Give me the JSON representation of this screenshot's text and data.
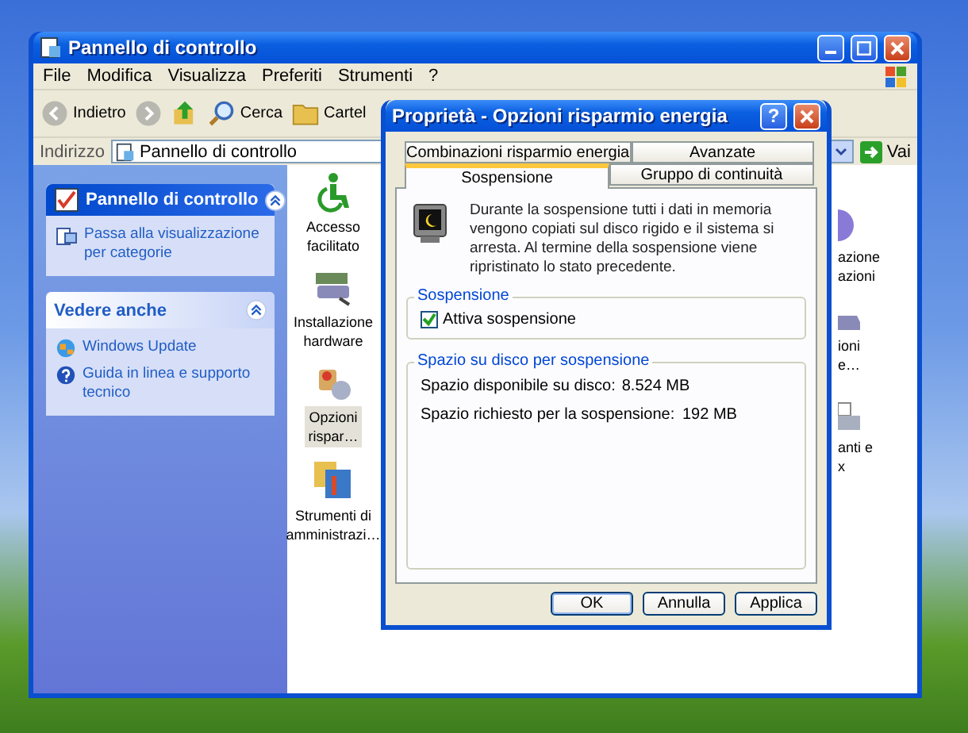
{
  "explorer": {
    "title": "Pannello di controllo",
    "menu": [
      "File",
      "Modifica",
      "Visualizza",
      "Preferiti",
      "Strumenti",
      "?"
    ],
    "toolbar": [
      {
        "kind": "back",
        "label": "Indietro"
      },
      {
        "kind": "forward"
      },
      {
        "kind": "up"
      },
      {
        "kind": "search",
        "label": "Cerca"
      },
      {
        "kind": "folders",
        "label": "Cartel"
      }
    ],
    "address": {
      "label": "Indirizzo",
      "value": "Pannello di controllo",
      "go": "Vai"
    },
    "sidebar": [
      {
        "kind": "primary",
        "title": "Pannello di controllo",
        "links": [
          {
            "kind": "switch",
            "label": "Passa alla visualizzazione per categorie"
          }
        ]
      },
      {
        "kind": "secondary",
        "title": "Vedere anche",
        "links": [
          {
            "kind": "update",
            "label": "Windows Update"
          },
          {
            "kind": "help",
            "label": "Guida in linea e supporto tecnico"
          }
        ]
      }
    ],
    "items": [
      {
        "kind": "accessibility",
        "lines": [
          "Accesso",
          "facilitato"
        ],
        "selected": false
      },
      {
        "kind": "hardware",
        "lines": [
          "Installazione",
          "hardware"
        ],
        "selected": false
      },
      {
        "kind": "power",
        "lines": [
          "Opzioni",
          "rispar…"
        ],
        "selected": true
      },
      {
        "kind": "tools",
        "lines": [
          "Strumenti di",
          "amministrazi…"
        ],
        "selected": false
      }
    ],
    "cut_items": [
      {
        "kind": "globe",
        "lines": [
          "azione",
          "azioni"
        ]
      },
      {
        "kind": "drive",
        "lines": [
          "ioni",
          "e…"
        ]
      },
      {
        "kind": "printer",
        "lines": [
          "anti e",
          "x"
        ]
      }
    ]
  },
  "dialog": {
    "title": "Proprietà - Opzioni risparmio energia",
    "help": "?",
    "tab_rows": [
      [
        {
          "label": "Combinazioni risparmio energia",
          "selected": false
        },
        {
          "label": "Avanzate",
          "selected": false
        }
      ],
      [
        {
          "label": "Sospensione",
          "selected": true
        },
        {
          "label": "Gruppo di continuità",
          "selected": false
        }
      ]
    ],
    "description": "Durante la sospensione tutti i dati in memoria vengono copiati sul disco rigido e il sistema si arresta. Al termine della sospensione viene ripristinato lo stato precedente.",
    "groups": [
      {
        "kind": "checkbox",
        "title": "Sospensione",
        "label": "Attiva sospensione",
        "checked": true
      },
      {
        "kind": "info",
        "title": "Spazio su disco per sospensione",
        "rows": [
          {
            "label": "Spazio disponibile su disco:",
            "value": "8.524 MB"
          },
          {
            "label": "Spazio richiesto per la sospensione:",
            "value": "192 MB"
          }
        ]
      }
    ],
    "buttons": [
      {
        "label": "OK",
        "focused": true
      },
      {
        "label": "Annulla",
        "focused": false
      },
      {
        "label": "Applica",
        "focused": false
      }
    ]
  }
}
